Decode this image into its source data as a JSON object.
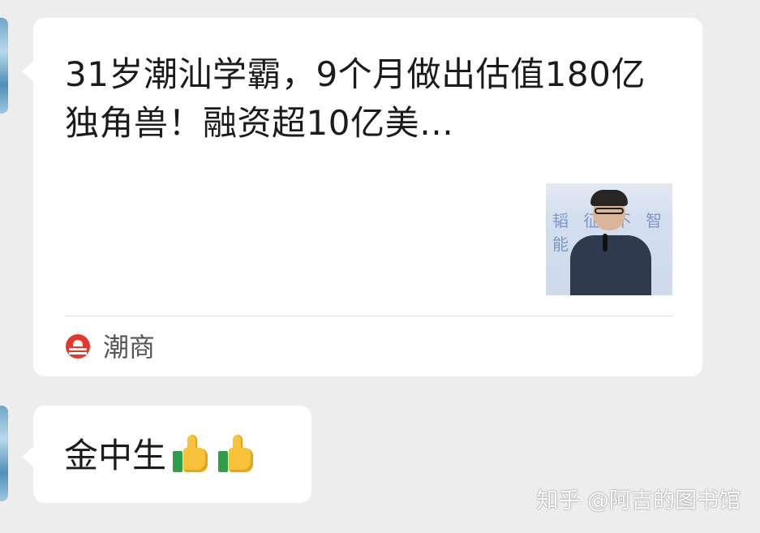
{
  "chat": {
    "messages": [
      {
        "type": "link_card",
        "title": "31岁潮汕学霸，9个月做出估值180亿独角兽！融资超10亿美…",
        "thumbnail_icon": "speaker-photo",
        "thumbnail_bg_text": "韬 征 不 智 能",
        "source": {
          "name": "潮商",
          "icon": "chaoshang-logo-icon",
          "color": "#e5382c"
        }
      },
      {
        "type": "text",
        "text": "金中生",
        "emoji": [
          "thumbs-up-icon",
          "thumbs-up-icon"
        ]
      }
    ]
  },
  "watermark": "知乎 @阿吉的图书馆",
  "colors": {
    "background": "#ededed",
    "bubble": "#ffffff",
    "text": "#1b1b1b"
  }
}
